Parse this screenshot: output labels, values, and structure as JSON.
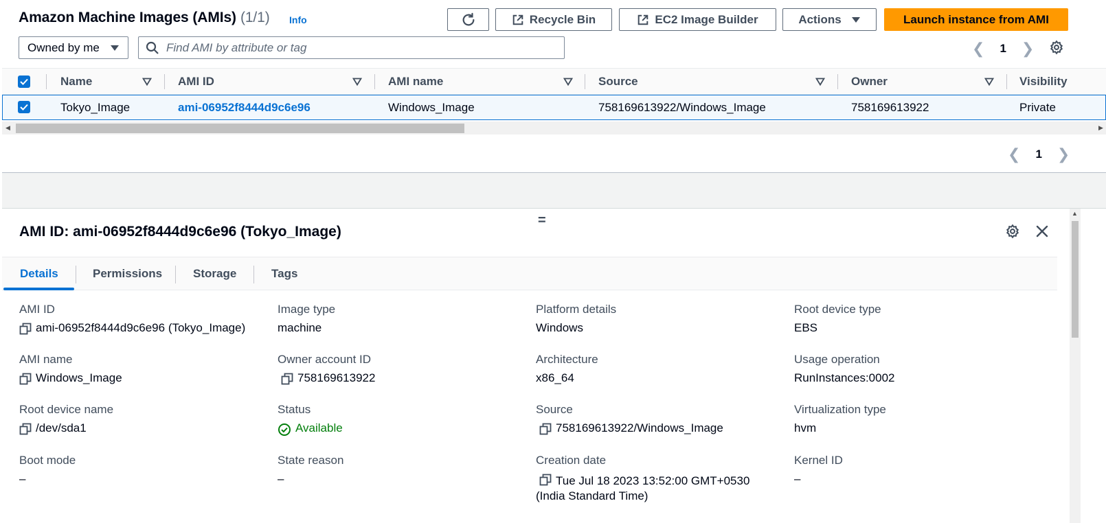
{
  "header": {
    "title": "Amazon Machine Images (AMIs)",
    "count": "(1/1)",
    "info": "Info"
  },
  "toolbar": {
    "recycle_bin": "Recycle Bin",
    "image_builder": "EC2 Image Builder",
    "actions": "Actions",
    "launch": "Launch instance from AMI"
  },
  "filter": {
    "owner_select": "Owned by me",
    "search_placeholder": "Find AMI by attribute or tag"
  },
  "pagination": {
    "page": "1"
  },
  "table": {
    "columns": [
      "Name",
      "AMI ID",
      "AMI name",
      "Source",
      "Owner",
      "Visibility"
    ],
    "rows": [
      {
        "name": "Tokyo_Image",
        "ami_id": "ami-06952f8444d9c6e96",
        "ami_name": "Windows_Image",
        "source": "758169613922/Windows_Image",
        "owner": "758169613922",
        "visibility": "Private"
      }
    ]
  },
  "details": {
    "title": "AMI ID: ami-06952f8444d9c6e96 (Tokyo_Image)",
    "tabs": [
      "Details",
      "Permissions",
      "Storage",
      "Tags"
    ],
    "fields": [
      {
        "label": "AMI ID",
        "value": "ami-06952f8444d9c6e96 (Tokyo_Image)",
        "copy": true
      },
      {
        "label": "Image type",
        "value": "machine"
      },
      {
        "label": "Platform details",
        "value": "Windows"
      },
      {
        "label": "Root device type",
        "value": "EBS"
      },
      {
        "label": "AMI name",
        "value": "Windows_Image",
        "copy": true
      },
      {
        "label": "Owner account ID",
        "value": "758169613922",
        "copy": true
      },
      {
        "label": "Architecture",
        "value": "x86_64"
      },
      {
        "label": "Usage operation",
        "value": "RunInstances:0002"
      },
      {
        "label": "Root device name",
        "value": "/dev/sda1",
        "copy": true
      },
      {
        "label": "Status",
        "value": "Available"
      },
      {
        "label": "Source",
        "value": "758169613922/Windows_Image",
        "copy": true
      },
      {
        "label": "Virtualization type",
        "value": "hvm"
      },
      {
        "label": "Boot mode",
        "value": "–"
      },
      {
        "label": "State reason",
        "value": "–"
      },
      {
        "label": "Creation date",
        "value": "Tue Jul 18 2023 13:52:00 GMT+0530 (India Standard Time)",
        "copy": true
      },
      {
        "label": "Kernel ID",
        "value": "–"
      }
    ]
  },
  "colors": {
    "accent": "#0972d3",
    "primary_button": "#ff9900",
    "success": "#037f0c"
  }
}
